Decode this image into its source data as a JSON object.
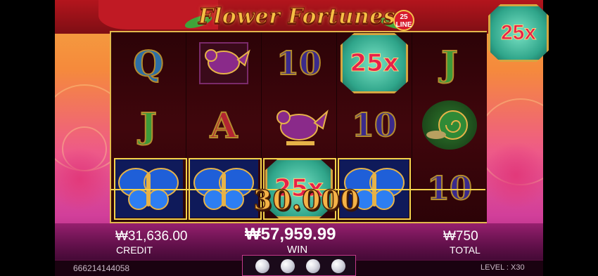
{
  "game": {
    "title": "Flower Fortunes",
    "line_badge": "25 LINE",
    "top_multiplier": "25x"
  },
  "reels": {
    "columns": [
      [
        "Q",
        "J",
        "butterfly"
      ],
      [
        "bird",
        "A",
        "butterfly"
      ],
      [
        "10",
        "bird",
        "25x"
      ],
      [
        "25x",
        "10",
        "butterfly"
      ],
      [
        "J",
        "snail",
        "10"
      ]
    ]
  },
  "win_amount_overlay": "30.000",
  "bottom": {
    "credit_value": "₩31,636.00",
    "credit_label": "CREDIT",
    "win_value": "₩57,959.99",
    "win_label": "WIN",
    "total_value": "₩750",
    "total_label": "TOTAL"
  },
  "footer": {
    "player_id": "666214144058",
    "level_text": "LEVEL : X30"
  },
  "colors": {
    "reel_bg": "#2a0306",
    "gold": "#f3d24b",
    "banner_red": "#b3151d"
  }
}
